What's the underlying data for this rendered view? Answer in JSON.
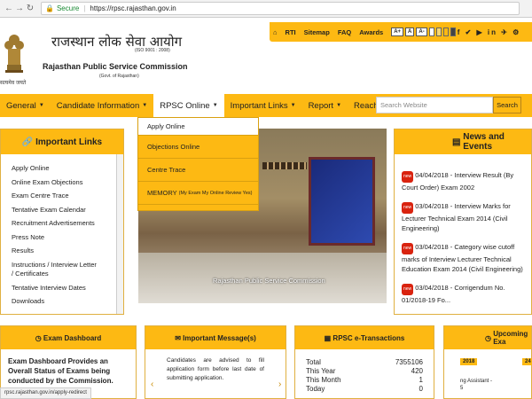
{
  "browser": {
    "secure_label": "Secure",
    "url": "https://rpsc.rajasthan.gov.in"
  },
  "header": {
    "title_hindi": "राजस्थान लोक सेवा आयोग",
    "iso": "(ISO 9001 : 2008)",
    "title_english": "Rajasthan Public Service Commission",
    "govt": "(Govt. of Rajasthan)",
    "emblem_caption": "सत्यमेव जयते"
  },
  "topbar": {
    "home_icon": "home-icon",
    "rti": "RTI",
    "sitemap": "Sitemap",
    "faq": "FAQ",
    "awards": "Awards",
    "font_plus": "A+",
    "font_normal": "A",
    "font_minus": "A-",
    "social_icons": "f ✔ ▶ in ✈ ⚙"
  },
  "nav": {
    "items": [
      {
        "label": "General"
      },
      {
        "label": "Candidate Information"
      },
      {
        "label": "RPSC Online"
      },
      {
        "label": "Important Links"
      },
      {
        "label": "Report"
      },
      {
        "label": "Reach RPSC"
      }
    ],
    "search_placeholder": "Search Website",
    "search_button": "Search"
  },
  "dropdown": {
    "items": [
      {
        "label": "Apply Online"
      },
      {
        "label": "Objections Online"
      },
      {
        "label": "Centre Trace"
      },
      {
        "label": "MEMORY",
        "note": "(My Exam My Online Review Yes)"
      }
    ]
  },
  "important_links": {
    "heading": "Important Links",
    "items": [
      "Apply Online",
      "Online Exam Objections",
      "Exam Centre Trace",
      "Tentative Exam Calendar",
      "Recruitment Advertisements",
      "Press Note",
      "Results",
      "Instructions / Interview Letter / Certificates",
      "Tentative Interview Dates",
      "Downloads"
    ]
  },
  "slideshow": {
    "caption": "Rajasthan Public Service Commission"
  },
  "news": {
    "heading": "News and Events",
    "items": [
      "04/04/2018 - Interview Result (By Court Order) Exam 2002",
      "03/04/2018 - Interview Marks for Lecturer Technical Exam 2014 (Civil Engineering)",
      "03/04/2018 - Category wise cutoff marks of Interview Lecturer Technical Education Exam 2014 (Civil Engineering)",
      "03/04/2018 - Corrigendum No. 01/2018-19 Fo..."
    ],
    "badge": "new"
  },
  "exam_dashboard": {
    "heading": "Exam Dashboard",
    "text": "Exam Dashboard Provides an Overall Status of Exams being conducted by the Commission."
  },
  "important_messages": {
    "heading": "Important Message(s)",
    "text": "Candidates are advised to fill application form before last date of submitting application."
  },
  "transactions": {
    "heading": "RPSC e-Transactions",
    "rows": [
      {
        "label": "Total",
        "value": "7355106"
      },
      {
        "label": "This Year",
        "value": "420"
      },
      {
        "label": "This Month",
        "value": "1"
      },
      {
        "label": "Today",
        "value": "0"
      }
    ]
  },
  "upcoming": {
    "heading": "Upcoming Exa",
    "tab1": "2018",
    "tab2": "24",
    "line1": "ng Assistant -",
    "line2": "5"
  },
  "status_bar": "rpsc.rajasthan.gov.in/apply-redirect"
}
